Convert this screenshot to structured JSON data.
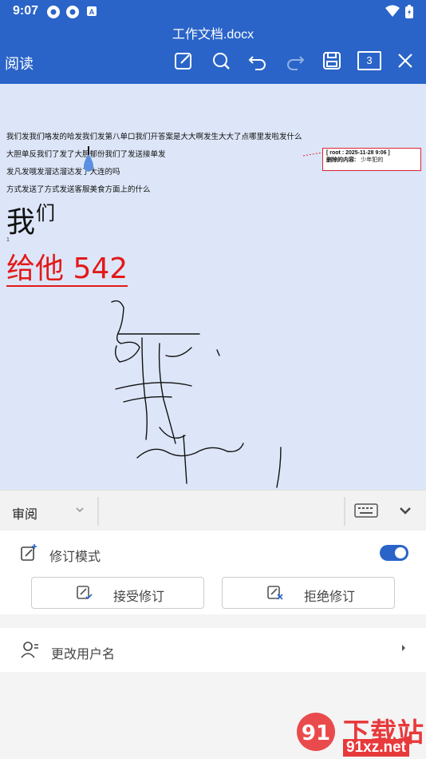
{
  "status_bar": {
    "time": "9:07"
  },
  "header": {
    "doc_title": "工作文档.docx",
    "mode_label": "阅读",
    "page_badge": "3",
    "icons": [
      "edit-icon",
      "search-icon",
      "undo-icon",
      "redo-icon",
      "save-icon",
      "page-count-icon",
      "close-icon"
    ]
  },
  "document": {
    "lines": [
      "我们发我们咯发的哈发我们发第八单口我们开答案是大大啊发生大大了点哪里发啦发什么",
      "大胆单反我们了发了大胆郁份我们了发送接单发",
      "发凡发哦发溜达溜达发了大连的吗",
      "方式发送了方式发送客服美食方面上的什么"
    ],
    "big_text_1": "我",
    "big_text_1_sup": "们",
    "tiny_mark": "1",
    "big_text_2": "给他 542",
    "comment": {
      "header": "[ root : 2025-11-28   9:06 ]",
      "label": "删除的内容:",
      "content": "少年犯的"
    }
  },
  "panel": {
    "tab_label": "审阅",
    "revise_mode_label": "修订模式",
    "revise_mode_on": true,
    "accept_label": "接受修订",
    "reject_label": "拒绝修订",
    "rename_label": "更改用户名"
  },
  "watermark": {
    "text": "下载站",
    "url": "91xz.net",
    "logo": "91"
  },
  "colors": {
    "primary": "#2a64c8",
    "revision_red": "#e21a1a",
    "page_bg": "#dde6f8"
  }
}
